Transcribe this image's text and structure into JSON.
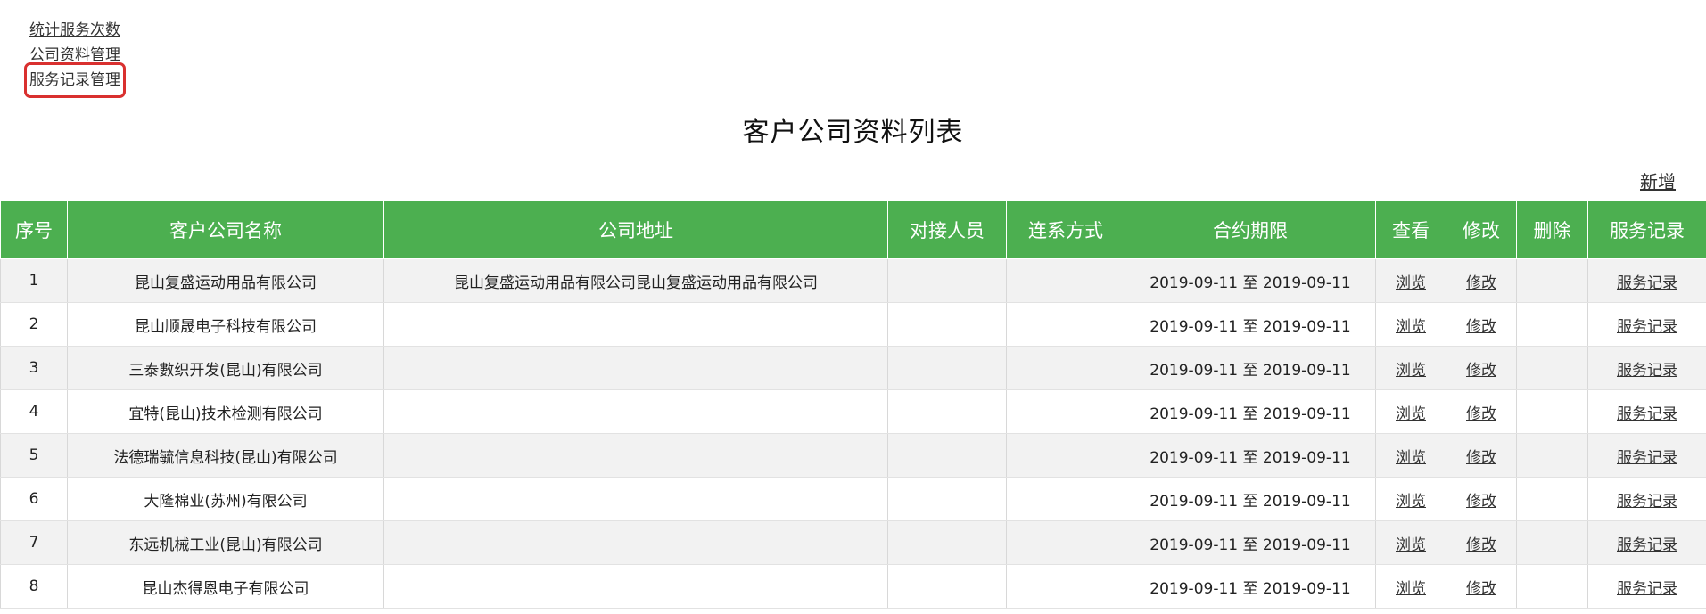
{
  "nav": {
    "items": [
      {
        "label": "统计服务次数"
      },
      {
        "label": "公司资料管理"
      },
      {
        "label": "服务记录管理"
      }
    ]
  },
  "page_title": "客户公司资料列表",
  "add_label": "新增",
  "table": {
    "headers": [
      "序号",
      "客户公司名称",
      "公司地址",
      "对接人员",
      "连系方式",
      "合约期限",
      "查看",
      "修改",
      "删除",
      "服务记录"
    ],
    "rows": [
      {
        "no": "1",
        "name": "昆山复盛运动用品有限公司",
        "address": "昆山复盛运动用品有限公司昆山复盛运动用品有限公司",
        "contact": "",
        "phone": "",
        "term": "2019-09-11 至 2019-09-11",
        "view": "浏览",
        "edit": "修改",
        "delete": "",
        "records": "服务记录"
      },
      {
        "no": "2",
        "name": "昆山顺晟电子科技有限公司",
        "address": "",
        "contact": "",
        "phone": "",
        "term": "2019-09-11 至 2019-09-11",
        "view": "浏览",
        "edit": "修改",
        "delete": "",
        "records": "服务记录"
      },
      {
        "no": "3",
        "name": "三泰數织开发(昆山)有限公司",
        "address": "",
        "contact": "",
        "phone": "",
        "term": "2019-09-11 至 2019-09-11",
        "view": "浏览",
        "edit": "修改",
        "delete": "",
        "records": "服务记录"
      },
      {
        "no": "4",
        "name": "宜特(昆山)技术检测有限公司",
        "address": "",
        "contact": "",
        "phone": "",
        "term": "2019-09-11 至 2019-09-11",
        "view": "浏览",
        "edit": "修改",
        "delete": "",
        "records": "服务记录"
      },
      {
        "no": "5",
        "name": "法德瑞毓信息科技(昆山)有限公司",
        "address": "",
        "contact": "",
        "phone": "",
        "term": "2019-09-11 至 2019-09-11",
        "view": "浏览",
        "edit": "修改",
        "delete": "",
        "records": "服务记录"
      },
      {
        "no": "6",
        "name": "大隆棉业(苏州)有限公司",
        "address": "",
        "contact": "",
        "phone": "",
        "term": "2019-09-11 至 2019-09-11",
        "view": "浏览",
        "edit": "修改",
        "delete": "",
        "records": "服务记录"
      },
      {
        "no": "7",
        "name": "东远机械工业(昆山)有限公司",
        "address": "",
        "contact": "",
        "phone": "",
        "term": "2019-09-11 至 2019-09-11",
        "view": "浏览",
        "edit": "修改",
        "delete": "",
        "records": "服务记录"
      },
      {
        "no": "8",
        "name": "昆山杰得恩电子有限公司",
        "address": "",
        "contact": "",
        "phone": "",
        "term": "2019-09-11 至 2019-09-11",
        "view": "浏览",
        "edit": "修改",
        "delete": "",
        "records": "服务记录"
      }
    ]
  },
  "colors": {
    "header_bg": "#4caf50",
    "highlight_border": "#d9302f",
    "odd_row_bg": "#f2f2f2"
  }
}
